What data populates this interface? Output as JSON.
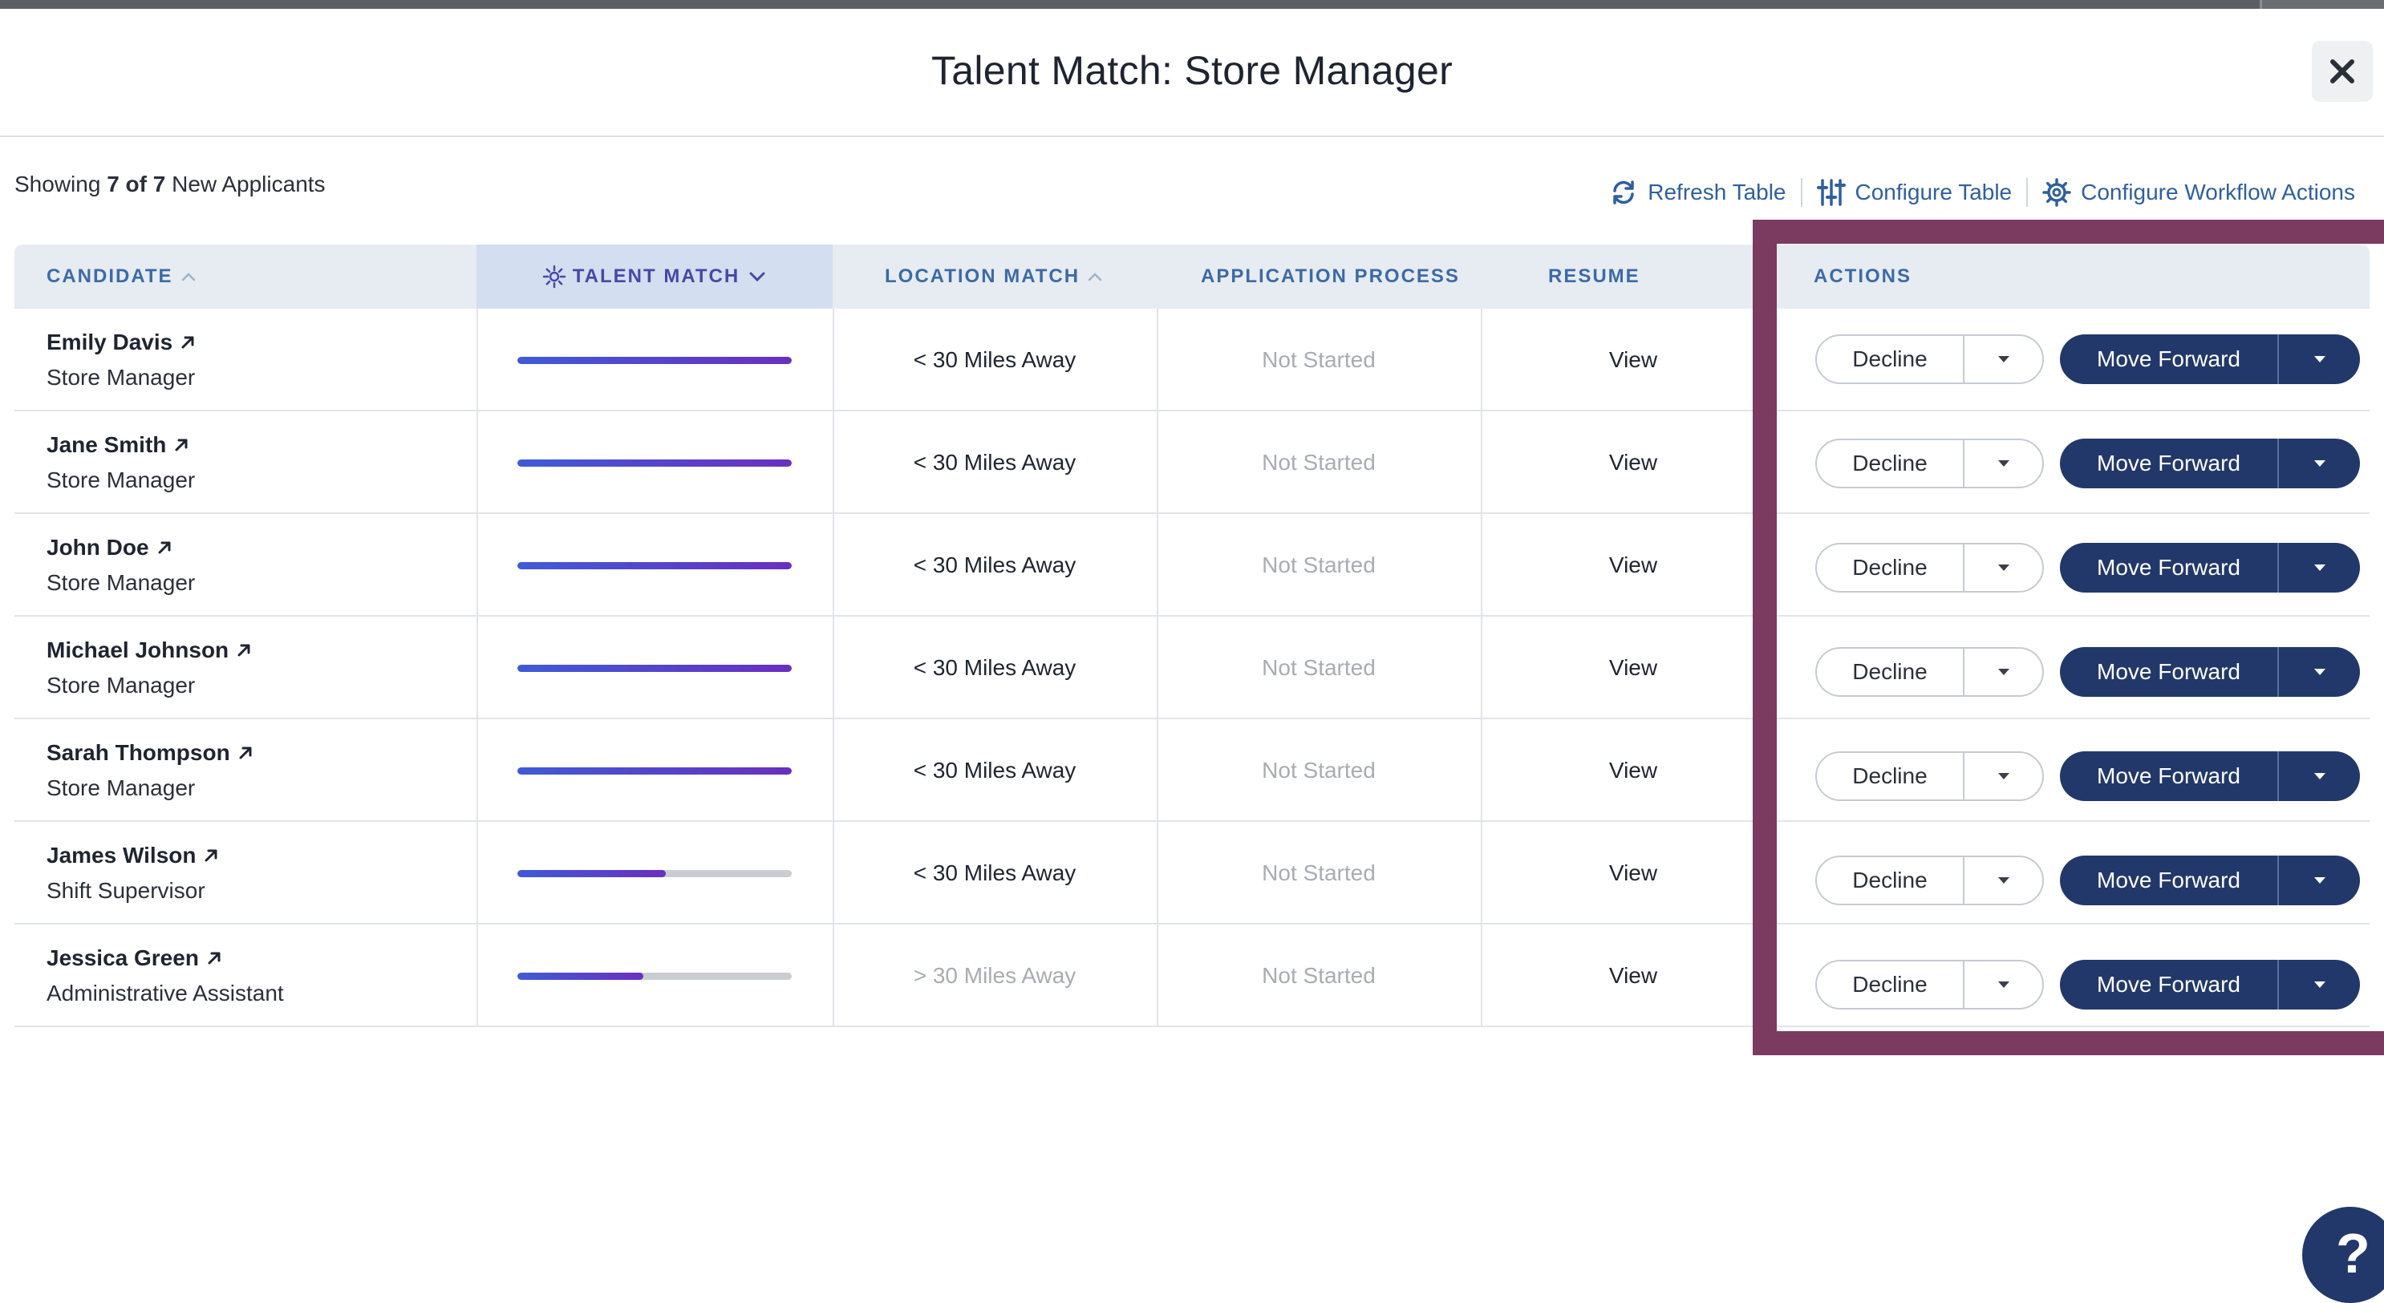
{
  "modal": {
    "title": "Talent Match: Store Manager"
  },
  "summary": {
    "prefix": "Showing ",
    "shown": "7 of 7",
    "suffix": " New Applicants"
  },
  "toolbar": {
    "refresh_label": "Refresh Table",
    "configure_table_label": "Configure Table",
    "configure_workflow_label": "Configure Workflow Actions",
    "refresh_icon": "refresh-icon",
    "configure_table_icon": "sliders-icon",
    "configure_workflow_icon": "gear-icon"
  },
  "columns": {
    "candidate": "CANDIDATE",
    "talent_match": "TALENT MATCH",
    "location_match": "LOCATION MATCH",
    "application_process": "APPLICATION PROCESS",
    "resume": "RESUME",
    "actions": "ACTIONS"
  },
  "actions": {
    "decline_label": "Decline",
    "forward_label": "Move Forward"
  },
  "rows": [
    {
      "name": "Emily Davis",
      "role": "Store Manager",
      "match": 1.0,
      "location": "< 30 Miles Away",
      "location_muted": false,
      "process": "Not Started",
      "resume": "View"
    },
    {
      "name": "Jane Smith",
      "role": "Store Manager",
      "match": 1.0,
      "location": "< 30 Miles Away",
      "location_muted": false,
      "process": "Not Started",
      "resume": "View"
    },
    {
      "name": "John Doe",
      "role": "Store Manager",
      "match": 1.0,
      "location": "< 30 Miles Away",
      "location_muted": false,
      "process": "Not Started",
      "resume": "View"
    },
    {
      "name": "Michael Johnson",
      "role": "Store Manager",
      "match": 1.0,
      "location": "< 30 Miles Away",
      "location_muted": false,
      "process": "Not Started",
      "resume": "View"
    },
    {
      "name": "Sarah Thompson",
      "role": "Store Manager",
      "match": 1.0,
      "location": "< 30 Miles Away",
      "location_muted": false,
      "process": "Not Started",
      "resume": "View"
    },
    {
      "name": "James Wilson",
      "role": "Shift Supervisor",
      "match": 0.54,
      "location": "< 30 Miles Away",
      "location_muted": false,
      "process": "Not Started",
      "resume": "View"
    },
    {
      "name": "Jessica Green",
      "role": "Administrative Assistant",
      "match": 0.46,
      "location": "> 30 Miles Away",
      "location_muted": true,
      "process": "Not Started",
      "resume": "View"
    }
  ],
  "help": {
    "label": "?"
  },
  "colors": {
    "accent": "#22386a",
    "link": "#2f5f9e",
    "highlight_border": "#7b3a60",
    "header_bg": "#e7ecf2"
  }
}
